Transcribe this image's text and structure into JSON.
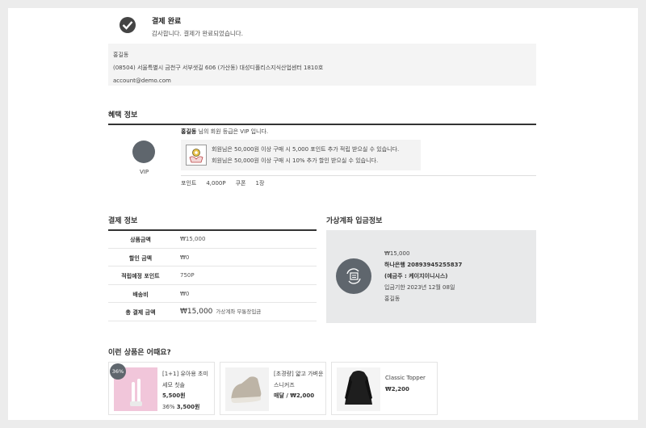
{
  "completion": {
    "title": "결제 완료",
    "message": "감사합니다. 결제가 완료되었습니다."
  },
  "address": {
    "name": "홍길동",
    "line": "(08504) 서울특별시 금천구 서부샛길 606 (가산동) 대성디폴리스지식산업센터 1810호",
    "email": "account@demo.com"
  },
  "benefit": {
    "section_title": "혜택 정보",
    "grade_label": "VIP",
    "grade_name": "홍길동",
    "grade_message": " 님의 회원 등급은 VIP 입니다.",
    "lines": [
      "회원님은 50,000원 이상 구매 시 5,000 포인트 추가 적립 받으실 수 있습니다.",
      "회원님은 50,000원 이상 구매 시 10% 추가 할인 받으실 수 있습니다."
    ],
    "points_label": "포인트",
    "points_value": "4,000P",
    "coupon_label": "쿠폰",
    "coupon_value": "1장"
  },
  "payment": {
    "section_title": "결제 정보",
    "rows": [
      {
        "label": "상품금액",
        "value": "₩15,000"
      },
      {
        "label": "할인 금액",
        "value": "₩0"
      },
      {
        "label": "적립예정 포인트",
        "value": "750P"
      },
      {
        "label": "배송비",
        "value": "₩0"
      }
    ],
    "total_label": "총 결제 금액",
    "total_value": "₩15,000",
    "total_note": "가상계좌 무통장입금"
  },
  "virtual_account": {
    "section_title": "가상계좌 입금정보",
    "amount": "₩15,000",
    "bank": "하나은행 20893945255837",
    "holder": "(예금주 : 케이지이니시스)",
    "deadline": "입금기한 2023년 12월 08일",
    "depositor": "홍길동"
  },
  "recommend": {
    "title": "이런 상품은 어때요?",
    "items": [
      {
        "name": "[1+1] 유아용 초미세모 칫솔",
        "price": "5,500원",
        "badge": "36%",
        "discount_rate": "36%",
        "sale_price": "3,500원"
      },
      {
        "name": "[초경량] 얇고 가벼운 스니커즈",
        "price": "매달 / ₩2,000"
      },
      {
        "name": "Classic Topper",
        "price": "₩2,200"
      }
    ]
  },
  "colors": {
    "accent_dark": "#5f666d",
    "panel_bg": "#e8e9ea",
    "light_bg": "#f4f4f4"
  },
  "icons": [
    "check-circle-icon",
    "benefit-gift-icon",
    "bank-transfer-icon"
  ]
}
